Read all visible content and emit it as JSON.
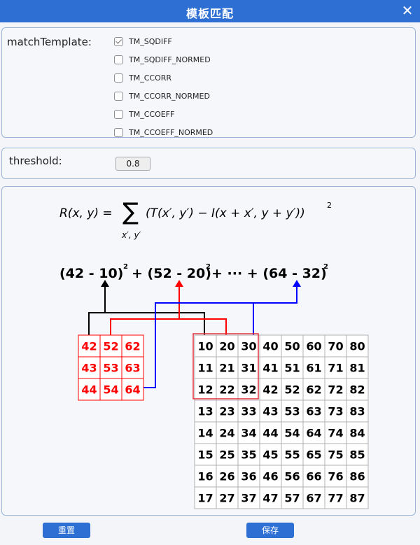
{
  "window": {
    "title": "模板匹配",
    "close_icon": "✕"
  },
  "match_template": {
    "label": "matchTemplate:",
    "methods": [
      {
        "label": "TM_SQDIFF",
        "checked": true
      },
      {
        "label": "TM_SQDIFF_NORMED",
        "checked": false
      },
      {
        "label": "TM_CCORR",
        "checked": false
      },
      {
        "label": "TM_CCORR_NORMED",
        "checked": false
      },
      {
        "label": "TM_CCOEFF",
        "checked": false
      },
      {
        "label": "TM_CCOEFF_NORMED",
        "checked": false
      }
    ]
  },
  "threshold": {
    "label": "threshold:",
    "value": "0.8"
  },
  "illustration": {
    "formula": {
      "lhs": "R(x, y) =",
      "sum_symbol": "∑",
      "sum_sub": "x′, y′",
      "body": "(T(x′, y′) − I(x + x′, y + y′))",
      "exponent": "2"
    },
    "expansion": {
      "t1": "(42 - 10)",
      "t2": "+ (52 - 20)",
      "t3": "+ ··· + (64 - 32)",
      "exp": "2",
      "colors": {
        "first": "#000000",
        "second": "#ff0000",
        "last": "#0000ff"
      }
    },
    "template_grid": [
      [
        "42",
        "52",
        "62"
      ],
      [
        "43",
        "53",
        "63"
      ],
      [
        "44",
        "54",
        "64"
      ]
    ],
    "image_grid": [
      [
        "10",
        "20",
        "30",
        "40",
        "50",
        "60",
        "70",
        "80"
      ],
      [
        "11",
        "21",
        "31",
        "41",
        "51",
        "61",
        "71",
        "81"
      ],
      [
        "12",
        "22",
        "32",
        "42",
        "52",
        "62",
        "72",
        "82"
      ],
      [
        "13",
        "23",
        "33",
        "43",
        "53",
        "63",
        "73",
        "83"
      ],
      [
        "14",
        "24",
        "34",
        "44",
        "54",
        "64",
        "74",
        "84"
      ],
      [
        "15",
        "25",
        "35",
        "45",
        "55",
        "65",
        "75",
        "85"
      ],
      [
        "16",
        "26",
        "36",
        "46",
        "56",
        "66",
        "76",
        "86"
      ],
      [
        "17",
        "27",
        "37",
        "47",
        "57",
        "67",
        "77",
        "87"
      ]
    ],
    "colors": {
      "template": "#ff0000",
      "image_text": "#000000",
      "highlight": "#e6303c"
    }
  },
  "buttons": {
    "reset": "重置",
    "save": "保存"
  },
  "theme": {
    "primary": "#2d6fd3",
    "panel_border": "#9cb4d8"
  }
}
